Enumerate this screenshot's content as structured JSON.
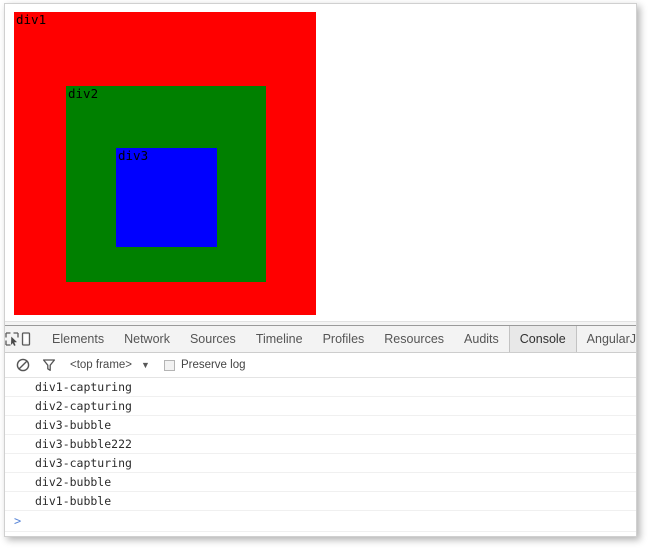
{
  "page": {
    "boxes": [
      {
        "id": "div1",
        "label": "div1",
        "color": "#ff0000"
      },
      {
        "id": "div2",
        "label": "div2",
        "color": "#008000"
      },
      {
        "id": "div3",
        "label": "div3",
        "color": "#0000ff"
      }
    ]
  },
  "devtools": {
    "toolbar_icons": [
      {
        "name": "inspect-element-icon",
        "title": "Inspect element"
      },
      {
        "name": "device-mode-icon",
        "title": "Toggle device mode"
      }
    ],
    "tabs": [
      {
        "label": "Elements",
        "active": false
      },
      {
        "label": "Network",
        "active": false
      },
      {
        "label": "Sources",
        "active": false
      },
      {
        "label": "Timeline",
        "active": false
      },
      {
        "label": "Profiles",
        "active": false
      },
      {
        "label": "Resources",
        "active": false
      },
      {
        "label": "Audits",
        "active": false
      },
      {
        "label": "Console",
        "active": true
      },
      {
        "label": "AngularJS",
        "active": false
      }
    ],
    "options_bar": {
      "clear_icon": "clear-console-icon",
      "filter_icon": "filter-icon",
      "frame_selector_value": "<top frame>",
      "frame_selector_caret": "▼",
      "preserve_log_label": "Preserve log",
      "preserve_log_checked": false
    },
    "console": {
      "messages": [
        "div1-capturing",
        "div2-capturing",
        "div3-bubble",
        "div3-bubble222",
        "div3-capturing",
        "div2-bubble",
        "div1-bubble"
      ],
      "prompt_chevron": ">",
      "prompt_value": ""
    }
  },
  "colors": {
    "div1": "#ff0000",
    "div2": "#008000",
    "div3": "#0000ff",
    "tab_active_bg": "#e8e8e8",
    "tabbar_bg": "#f3f3f3",
    "prompt_chevron": "#5b87d8"
  }
}
